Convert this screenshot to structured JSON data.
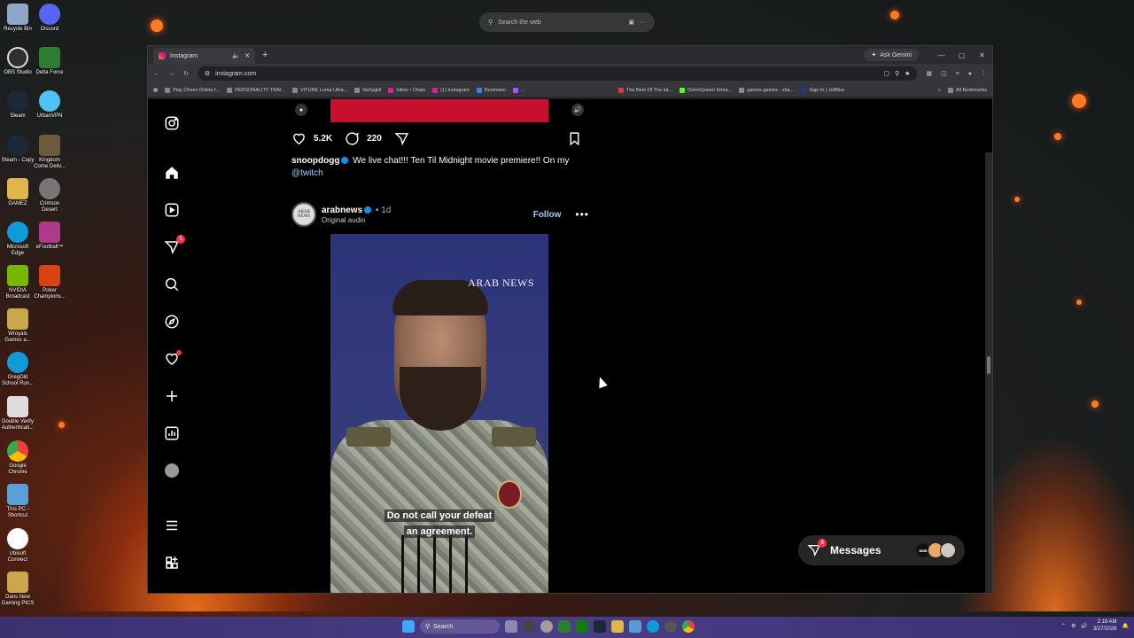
{
  "desktop": {
    "search": {
      "placeholder": "Search the web"
    },
    "icons": [
      {
        "label": "Recycle Bin",
        "color": "#8fa7c9"
      },
      {
        "label": "Discord",
        "color": "#5865f2"
      },
      {
        "label": "OBS Studio",
        "color": "#302e31"
      },
      {
        "label": "Delta Force",
        "color": "#2e7d32"
      },
      {
        "label": "Steam",
        "color": "#1b2838"
      },
      {
        "label": "UrbanVPN",
        "color": "#4fc3f7"
      },
      {
        "label": "Steam - Copy",
        "color": "#1b2838"
      },
      {
        "label": "Kingdom Come Deliv...",
        "color": "#6d5a3a"
      },
      {
        "label": "GAMEZ",
        "color": "#e0b54a"
      },
      {
        "label": "Crimson Desert",
        "color": "#777777"
      },
      {
        "label": "Microsoft Edge",
        "color": "#0f9bd7"
      },
      {
        "label": "eFootball™",
        "color": "#b03a8a"
      },
      {
        "label": "NVIDIA Broadcast",
        "color": "#76b900"
      },
      {
        "label": "Poker Champions...",
        "color": "#d84315"
      },
      {
        "label": "Wroyals Games a...",
        "color": "#c9a74a"
      },
      {
        "label": "GregOld School Run...",
        "color": "#0f9bd7"
      },
      {
        "label": "Double Verify Authenticati...",
        "color": "#dddddd"
      },
      {
        "label": "Google Chrome",
        "color": "#4285f4"
      },
      {
        "label": "This PC - Shortcut",
        "color": "#5aa0d8"
      },
      {
        "label": "Ubisoft Connect",
        "color": "#ffffff"
      },
      {
        "label": "Dans New Gaming PICS",
        "color": "#c9a74a"
      }
    ]
  },
  "browser": {
    "tab_title": "Instagram",
    "new_tab": "+",
    "ask_gemini": "Ask Gemini",
    "url": "instagram.com",
    "bookmarks": [
      "Play Chess Online f...",
      "PERSONALITY TRAI...",
      "VITURE Luma Ultra...",
      "literlygkil",
      "Inbox • Chatx",
      "(1) Instagram",
      "Restream",
      "...",
      "The Best Of The lat...",
      "DelenQueen Strea...",
      "games games - sha...",
      "Sign In | JetBlue"
    ],
    "all_bookmarks": "All Bookmarks"
  },
  "instagram": {
    "nav": {
      "notifications_badge": "5"
    },
    "prev_post": {
      "likes": "5.2K",
      "comments": "220",
      "username": "snoopdogg",
      "caption": "We live chat!!! Ten Til Midnight movie premiere!! On my",
      "link": "@twitch"
    },
    "post": {
      "avatar_text": "ARAB NEWS",
      "username": "arabnews",
      "separator": "•",
      "time": "1d",
      "audio": "Original audio",
      "follow": "Follow",
      "more": "•••",
      "watermark": "ARAB NEWS",
      "subtitle_line1": "Do not call your defeat",
      "subtitle_line2": "an agreement."
    },
    "messages": {
      "label": "Messages",
      "badge": "3",
      "avatar_text": "BMB"
    }
  },
  "taskbar": {
    "search": "Search",
    "time": "2:18 AM",
    "date": "3/27/2026"
  },
  "colors": {
    "accent_link": "#a8c7fa",
    "badge_red": "#ff3040",
    "verified_blue": "#0095f6",
    "taskbar": "#4b3c86"
  }
}
